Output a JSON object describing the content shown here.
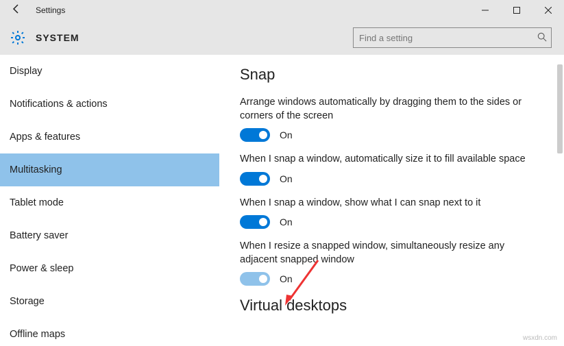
{
  "window": {
    "title": "Settings"
  },
  "header": {
    "title": "SYSTEM",
    "search_placeholder": "Find a setting"
  },
  "sidebar": {
    "items": [
      {
        "label": "Display",
        "selected": false
      },
      {
        "label": "Notifications & actions",
        "selected": false
      },
      {
        "label": "Apps & features",
        "selected": false
      },
      {
        "label": "Multitasking",
        "selected": true
      },
      {
        "label": "Tablet mode",
        "selected": false
      },
      {
        "label": "Battery saver",
        "selected": false
      },
      {
        "label": "Power & sleep",
        "selected": false
      },
      {
        "label": "Storage",
        "selected": false
      },
      {
        "label": "Offline maps",
        "selected": false
      }
    ]
  },
  "content": {
    "section_title": "Snap",
    "settings": [
      {
        "desc": "Arrange windows automatically by dragging them to the sides or corners of the screen",
        "state": "On",
        "on": true,
        "highlight": false
      },
      {
        "desc": "When I snap a window, automatically size it to fill available space",
        "state": "On",
        "on": true,
        "highlight": false
      },
      {
        "desc": "When I snap a window, show what I can snap next to it",
        "state": "On",
        "on": true,
        "highlight": false
      },
      {
        "desc": "When I resize a snapped window, simultaneously resize any adjacent snapped window",
        "state": "On",
        "on": true,
        "highlight": true
      }
    ],
    "next_section_title": "Virtual desktops"
  },
  "watermark": "wsxdn.com"
}
